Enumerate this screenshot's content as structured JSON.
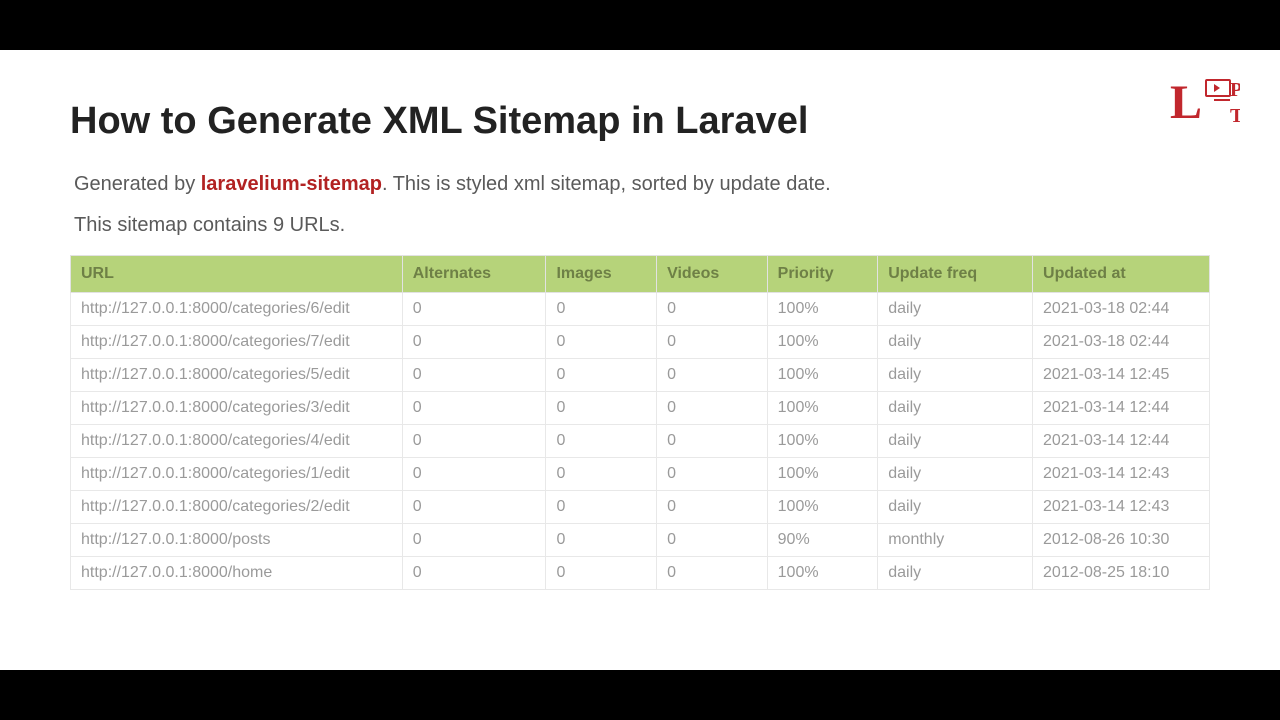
{
  "title": "How to Generate XML Sitemap in Laravel",
  "generated_prefix": "Generated by ",
  "generated_link": "laravelium-sitemap",
  "generated_suffix": ". This is styled xml sitemap, sorted by update date.",
  "count_text": "This sitemap contains 9 URLs.",
  "columns": [
    "URL",
    "Alternates",
    "Images",
    "Videos",
    "Priority",
    "Update freq",
    "Updated at"
  ],
  "rows": [
    {
      "url": "http://127.0.0.1:8000/categories/6/edit",
      "alternates": "0",
      "images": "0",
      "videos": "0",
      "priority": "100%",
      "freq": "daily",
      "updated": "2021-03-18 02:44"
    },
    {
      "url": "http://127.0.0.1:8000/categories/7/edit",
      "alternates": "0",
      "images": "0",
      "videos": "0",
      "priority": "100%",
      "freq": "daily",
      "updated": "2021-03-18 02:44"
    },
    {
      "url": "http://127.0.0.1:8000/categories/5/edit",
      "alternates": "0",
      "images": "0",
      "videos": "0",
      "priority": "100%",
      "freq": "daily",
      "updated": "2021-03-14 12:45"
    },
    {
      "url": "http://127.0.0.1:8000/categories/3/edit",
      "alternates": "0",
      "images": "0",
      "videos": "0",
      "priority": "100%",
      "freq": "daily",
      "updated": "2021-03-14 12:44"
    },
    {
      "url": "http://127.0.0.1:8000/categories/4/edit",
      "alternates": "0",
      "images": "0",
      "videos": "0",
      "priority": "100%",
      "freq": "daily",
      "updated": "2021-03-14 12:44"
    },
    {
      "url": "http://127.0.0.1:8000/categories/1/edit",
      "alternates": "0",
      "images": "0",
      "videos": "0",
      "priority": "100%",
      "freq": "daily",
      "updated": "2021-03-14 12:43"
    },
    {
      "url": "http://127.0.0.1:8000/categories/2/edit",
      "alternates": "0",
      "images": "0",
      "videos": "0",
      "priority": "100%",
      "freq": "daily",
      "updated": "2021-03-14 12:43"
    },
    {
      "url": "http://127.0.0.1:8000/posts",
      "alternates": "0",
      "images": "0",
      "videos": "0",
      "priority": "90%",
      "freq": "monthly",
      "updated": "2012-08-26 10:30"
    },
    {
      "url": "http://127.0.0.1:8000/home",
      "alternates": "0",
      "images": "0",
      "videos": "0",
      "priority": "100%",
      "freq": "daily",
      "updated": "2012-08-25 18:10"
    }
  ]
}
